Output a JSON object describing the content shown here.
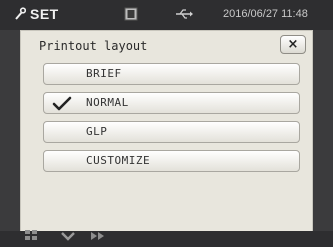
{
  "statusbar": {
    "mode_label": "SET",
    "datetime": "2016/06/27  11:48",
    "icons": [
      "wrench-icon",
      "lock-icon",
      "usb-icon"
    ]
  },
  "dialog": {
    "title": "Printout layout",
    "close_label": "×",
    "options": [
      {
        "label": "BRIEF",
        "selected": false
      },
      {
        "label": "NORMAL",
        "selected": true
      },
      {
        "label": "GLP",
        "selected": false
      },
      {
        "label": "CUSTOMIZE",
        "selected": false
      }
    ]
  },
  "bottombar": {
    "icons": [
      "grid-icon",
      "chevron-down-icon",
      "forward-icon"
    ]
  },
  "colors": {
    "statusbar_bg": "#2e2e30",
    "dialog_bg": "#e8e6dd",
    "button_border": "#a9a7a0",
    "check": "#222222"
  }
}
